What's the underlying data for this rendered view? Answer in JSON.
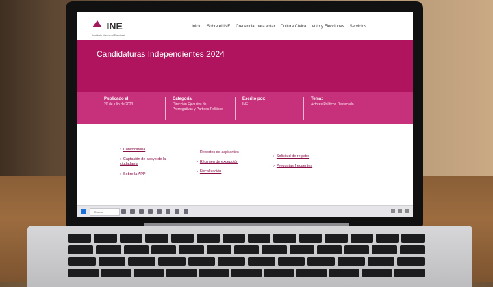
{
  "site": {
    "logo_text": "INE",
    "logo_subtitle": "Instituto Nacional Electoral",
    "nav": [
      "Inicio",
      "Sobre el INE",
      "Credencial para votar",
      "Cultura Cívica",
      "Voto y Elecciones",
      "Servicios"
    ]
  },
  "hero": {
    "title": "Candidaturas Independientes 2024"
  },
  "meta": [
    {
      "label": "Publicado el:",
      "value": "20 de julio de 2023"
    },
    {
      "label": "Categoría:",
      "value": "Dirección Ejecutiva de Prerrogativas y Partidos Políticos"
    },
    {
      "label": "Escrito por:",
      "value": "INE"
    },
    {
      "label": "Tema:",
      "value": "Actores Políticos Destacado"
    }
  ],
  "links": {
    "col1": [
      "Convocatoria",
      "Captación de apoyo de la ciudadanía",
      "Sobre la APP"
    ],
    "col2": [
      "Reportes de aspirantes",
      "Régimen de excepción",
      "Fiscalización"
    ],
    "col3": [
      "Solicitud de registro",
      "Preguntas frecuentes"
    ]
  },
  "taskbar": {
    "search_placeholder": "Buscar"
  },
  "colors": {
    "brand": "#b0145f",
    "brand_light": "#c7317c",
    "link": "#8a1048"
  },
  "icons": [
    "ine-logo-icon",
    "chevron-right-icon",
    "windows-start-icon",
    "search-icon"
  ]
}
